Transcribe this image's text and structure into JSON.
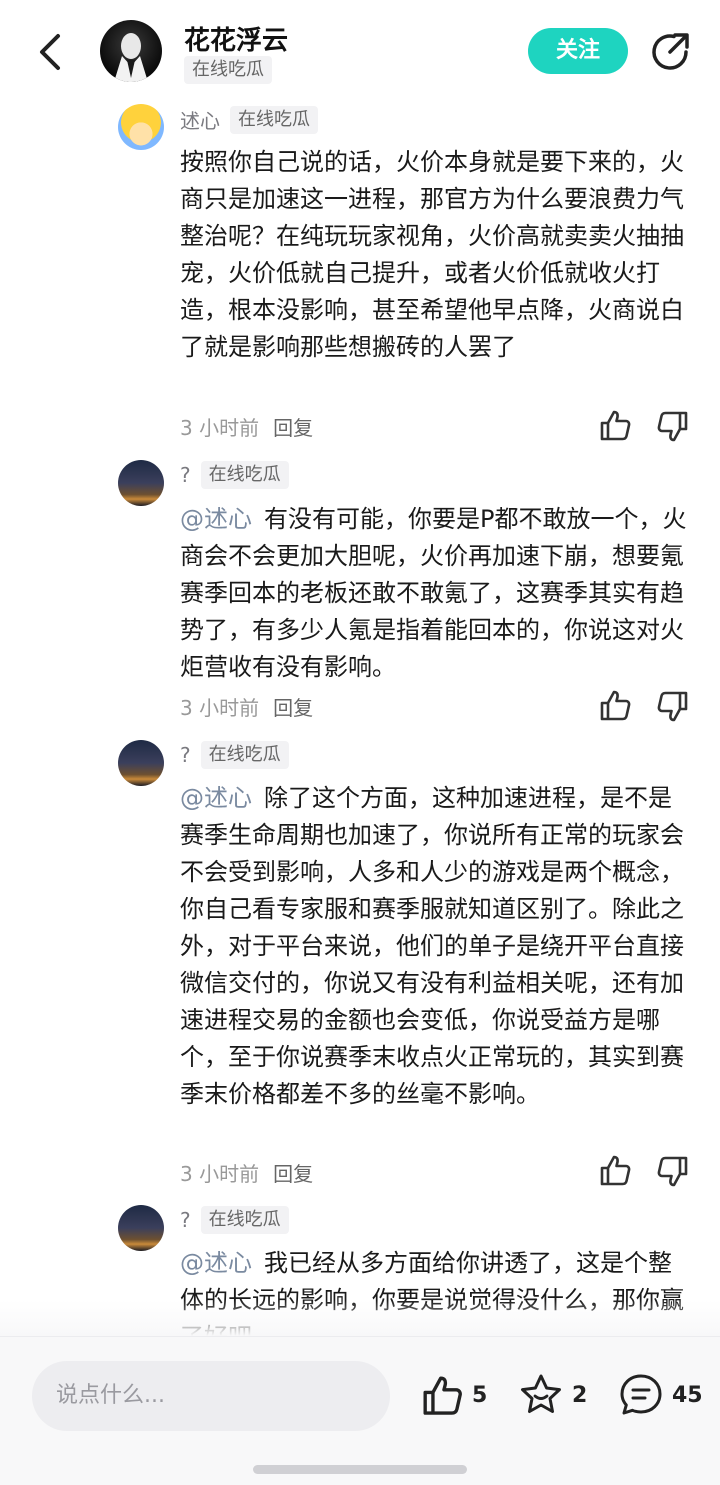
{
  "header": {
    "author_name": "花花浮云",
    "author_tag": "在线吃瓜",
    "follow_label": "关注"
  },
  "comments": [
    {
      "name": "述心",
      "tag": "在线吃瓜",
      "mention": "",
      "text": "按照你自己说的话，火价本身就是要下来的，火商只是加速这一进程，那官方为什么要浪费力气整治呢？在纯玩玩家视角，火价高就卖卖火抽抽宠，火价低就自己提升，或者火价低就收火打造，根本没影响，甚至希望他早点降，火商说白了就是影响那些想搬砖的人罢了",
      "time": "3 小时前",
      "reply_label": "回复"
    },
    {
      "name": "?",
      "tag": "在线吃瓜",
      "mention": "@述心",
      "text": "有没有可能，你要是P都不敢放一个，火商会不会更加大胆呢，火价再加速下崩，想要氪赛季回本的老板还敢不敢氪了，这赛季其实有趋势了，有多少人氪是指着能回本的，你说这对火炬营收有没有影响。",
      "time": "3 小时前",
      "reply_label": "回复"
    },
    {
      "name": "?",
      "tag": "在线吃瓜",
      "mention": "@述心",
      "text": "除了这个方面，这种加速进程，是不是赛季生命周期也加速了，你说所有正常的玩家会不会受到影响，人多和人少的游戏是两个概念，你自己看专家服和赛季服就知道区别了。除此之外，对于平台来说，他们的单子是绕开平台直接微信交付的，你说又有没有利益相关呢，还有加速进程交易的金额也会变低，你说受益方是哪个，至于你说赛季末收点火正常玩的，其实到赛季末价格都差不多的丝毫不影响。",
      "time": "3 小时前",
      "reply_label": "回复"
    },
    {
      "name": "?",
      "tag": "在线吃瓜",
      "mention": "@述心",
      "text": "我已经从多方面给你讲透了，这是个整体的长远的影响，你要是说觉得没什么，那你赢了好吧",
      "time": "",
      "reply_label": ""
    }
  ],
  "bottom_bar": {
    "input_placeholder": "说点什么...",
    "like_count": "5",
    "favorite_count": "2",
    "comment_count": "45"
  },
  "colors": {
    "accent": "#1ed4c0",
    "tag_bg": "#f2f2f4",
    "mention": "#7a8aa0"
  },
  "icons": [
    "back-icon",
    "share-icon",
    "thumbs-up-icon",
    "thumbs-down-icon",
    "star-icon",
    "comment-bubble-icon"
  ]
}
